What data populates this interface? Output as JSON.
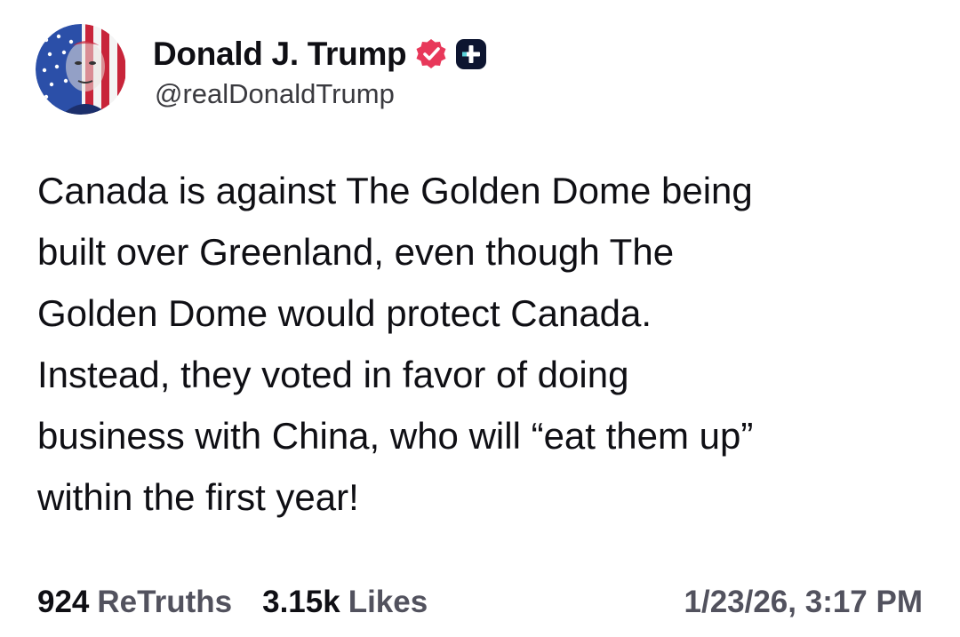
{
  "author": {
    "display_name": "Donald J. Trump",
    "handle": "@realDonaldTrump",
    "avatar_icon": "flag-portrait-avatar",
    "verified_icon": "verified-badge-icon",
    "verified_color": "#e8385a",
    "plus_icon": "subscribe-plus-icon"
  },
  "post": {
    "text": "Canada is against The Golden Dome being\nbuilt over Greenland, even though The\nGolden Dome would protect Canada.\nInstead, they voted in favor of doing\nbusiness with China, who will “eat them up”\nwithin the first year!",
    "retruths_count": "924",
    "retruths_label": "ReTruths",
    "likes_count": "3.15k",
    "likes_label": "Likes",
    "timestamp": "1/23/26, 3:17 PM"
  },
  "colors": {
    "text": "#0f0f14",
    "muted": "#52525e",
    "handle": "#3a3a3f"
  }
}
